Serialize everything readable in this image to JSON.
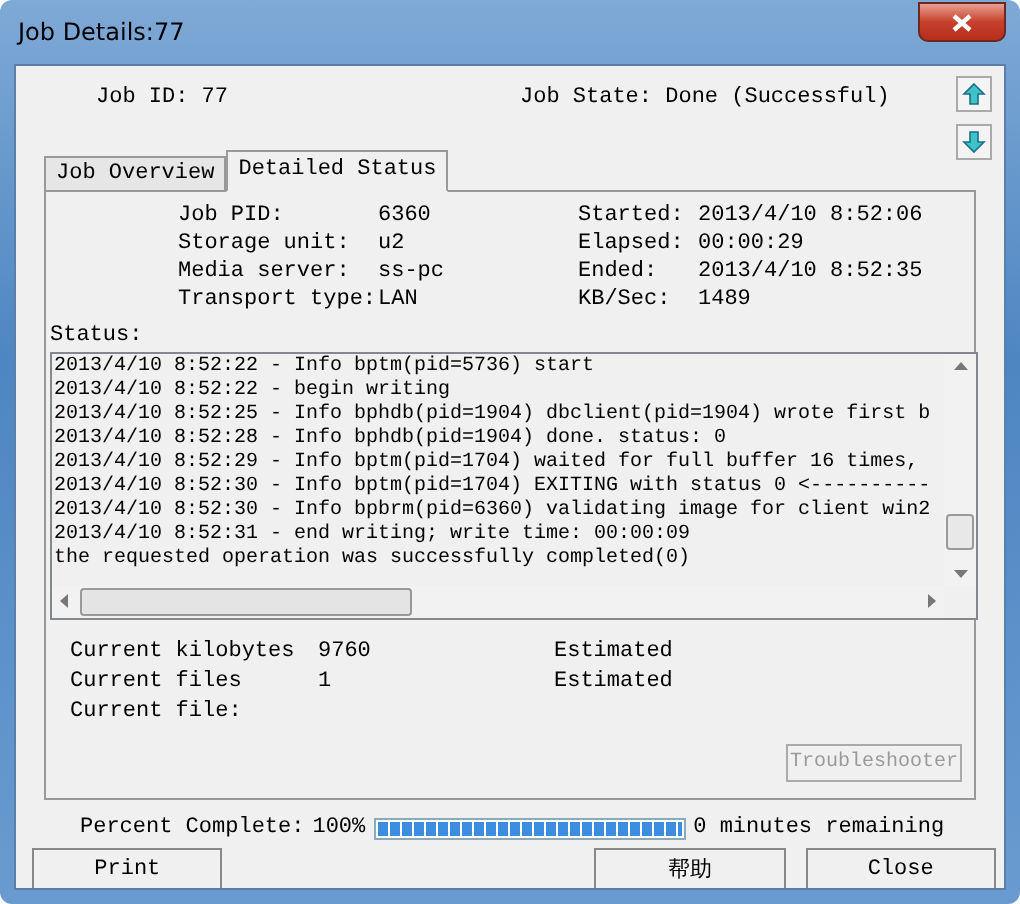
{
  "window": {
    "title": "Job Details:77"
  },
  "header": {
    "job_id": "Job ID: 77",
    "job_state": "Job State: Done (Successful)"
  },
  "tabs": [
    {
      "label": "Job Overview",
      "selected": false
    },
    {
      "label": "Detailed Status",
      "selected": true
    }
  ],
  "details_left": [
    {
      "label": "Job PID:",
      "value": "6360"
    },
    {
      "label": "Storage unit:",
      "value": "u2"
    },
    {
      "label": "Media server:",
      "value": "ss-pc"
    },
    {
      "label": "Transport type:",
      "value": "LAN"
    }
  ],
  "details_right": [
    {
      "label": "Started:",
      "value": "2013/4/10 8:52:06"
    },
    {
      "label": "Elapsed:",
      "value": "00:00:29"
    },
    {
      "label": "Ended:",
      "value": "2013/4/10 8:52:35"
    },
    {
      "label": "KB/Sec:",
      "value": "1489"
    }
  ],
  "status": {
    "label": "Status:",
    "lines": [
      "2013/4/10 8:52:22 - Info bptm(pid=5736) start",
      "2013/4/10 8:52:22 - begin writing",
      "2013/4/10 8:52:25 - Info bphdb(pid=1904) dbclient(pid=1904) wrote first b",
      "2013/4/10 8:52:28 - Info bphdb(pid=1904) done. status: 0",
      "2013/4/10 8:52:29 - Info bptm(pid=1704) waited for full buffer 16 times,",
      "2013/4/10 8:52:30 - Info bptm(pid=1704) EXITING with status 0 <----------",
      "2013/4/10 8:52:30 - Info bpbrm(pid=6360) validating image for client win2",
      "2013/4/10 8:52:31 - end writing; write time: 00:00:09",
      "the requested operation was successfully completed(0)"
    ]
  },
  "counters": [
    {
      "label": "Current kilobytes",
      "value": "9760",
      "estimated": "Estimated"
    },
    {
      "label": "Current files",
      "value": "1",
      "estimated": "Estimated"
    },
    {
      "label": "Current file:"
    }
  ],
  "troubleshooter": {
    "label": "Troubleshooter",
    "disabled": true
  },
  "progress": {
    "label": "Percent Complete:",
    "percent": "100%",
    "level": 1,
    "remaining": "0 minutes remaining"
  },
  "buttons": [
    "Print",
    "帮助",
    "Close"
  ]
}
